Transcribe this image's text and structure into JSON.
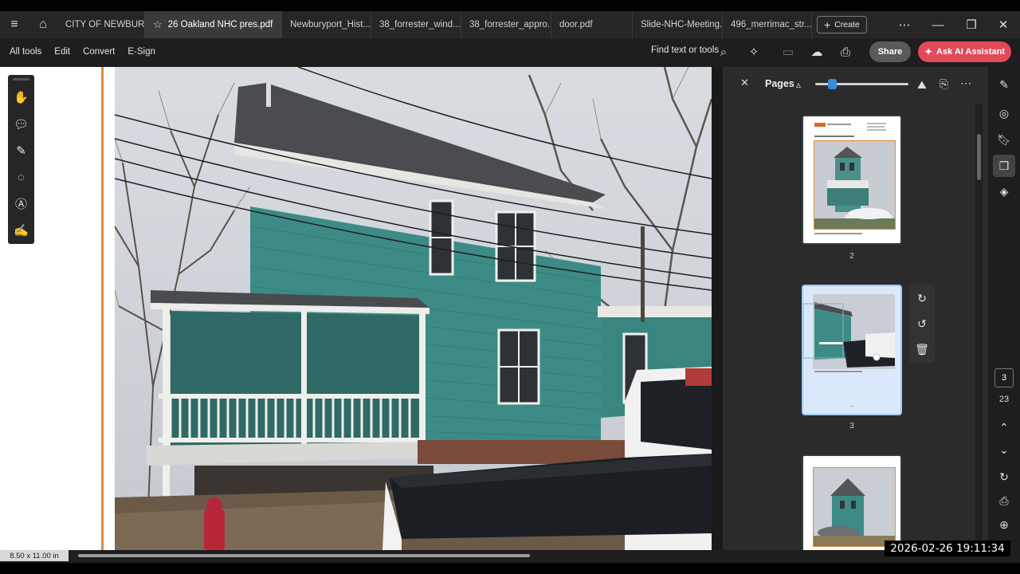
{
  "tabs": [
    {
      "label": "CITY OF NEWBUR...",
      "active": false
    },
    {
      "label": "26 Oakland NHC pres.pdf",
      "active": true
    },
    {
      "label": "Newburyport_Hist...",
      "active": false
    },
    {
      "label": "38_forrester_wind...",
      "active": false
    },
    {
      "label": "38_forrester_appro...",
      "active": false
    },
    {
      "label": "door.pdf",
      "active": false
    },
    {
      "label": "Slide-NHC-Meeting...",
      "active": false
    },
    {
      "label": "496_merrimac_str...",
      "active": false
    }
  ],
  "tabbar": {
    "create_label": "Create"
  },
  "toolbar": {
    "all_tools": "All tools",
    "edit": "Edit",
    "convert": "Convert",
    "esign": "E-Sign",
    "find": "Find text or tools",
    "share": "Share",
    "ai_assistant": "Ask AI Assistant"
  },
  "left_tools": [
    "hand-icon",
    "comment-icon",
    "pen-icon",
    "lasso-icon",
    "text-select-icon",
    "sign-icon"
  ],
  "pages_panel": {
    "title": "Pages",
    "zoom_fraction": 0.18,
    "thumbnails": [
      {
        "page_number": "2",
        "selected": false
      },
      {
        "page_number": "3",
        "selected": true
      },
      {
        "page_number": "",
        "selected": false
      }
    ],
    "thumb_actions": [
      "rotate-clockwise-icon",
      "rotate-counterclockwise-icon",
      "delete-icon"
    ]
  },
  "navigation": {
    "current_page": "3",
    "total_pages": "23"
  },
  "status": {
    "page_size": "8.50 x 11.00 in",
    "timestamp": "2026-02-26  19:11:34"
  },
  "colors": {
    "accent": "#e04a5a",
    "page_border": "#e08a3c",
    "house_siding": "#3d8b86",
    "selection": "#3b8bd9"
  }
}
